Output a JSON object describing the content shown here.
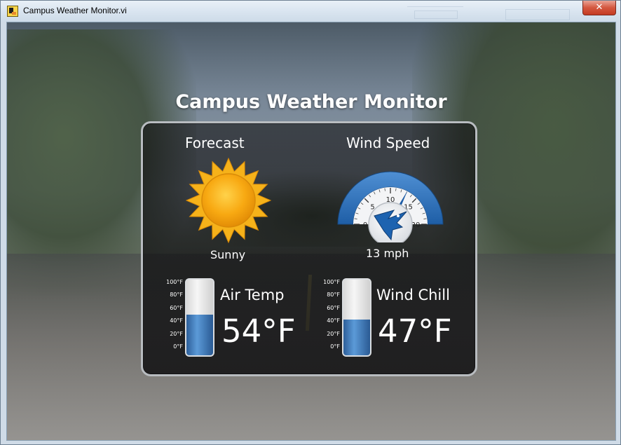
{
  "window": {
    "title": "Campus Weather Monitor.vi",
    "close_label": "✕"
  },
  "app": {
    "title": "Campus Weather Monitor"
  },
  "forecast": {
    "label": "Forecast",
    "condition": "Sunny",
    "icon": "sun-icon"
  },
  "wind": {
    "label": "Wind Speed",
    "value_mph": 13,
    "readout": "13 mph",
    "scale_min": 0,
    "scale_max": 20,
    "ticks": [
      "0",
      "5",
      "10",
      "15",
      "20"
    ],
    "logo_icon": "ni-eagle-logo"
  },
  "air_temp": {
    "label": "Air Temp",
    "readout": "54°F",
    "value_f": 54
  },
  "wind_chill": {
    "label": "Wind Chill",
    "readout": "47°F",
    "value_f": 47
  },
  "thermometer_scale": [
    "100°F",
    "80°F",
    "60°F",
    "40°F",
    "20°F",
    "0°F"
  ],
  "colors": {
    "accent": "#2e6db4",
    "sun": "#f5a410",
    "fill": "#3f7ec2"
  }
}
